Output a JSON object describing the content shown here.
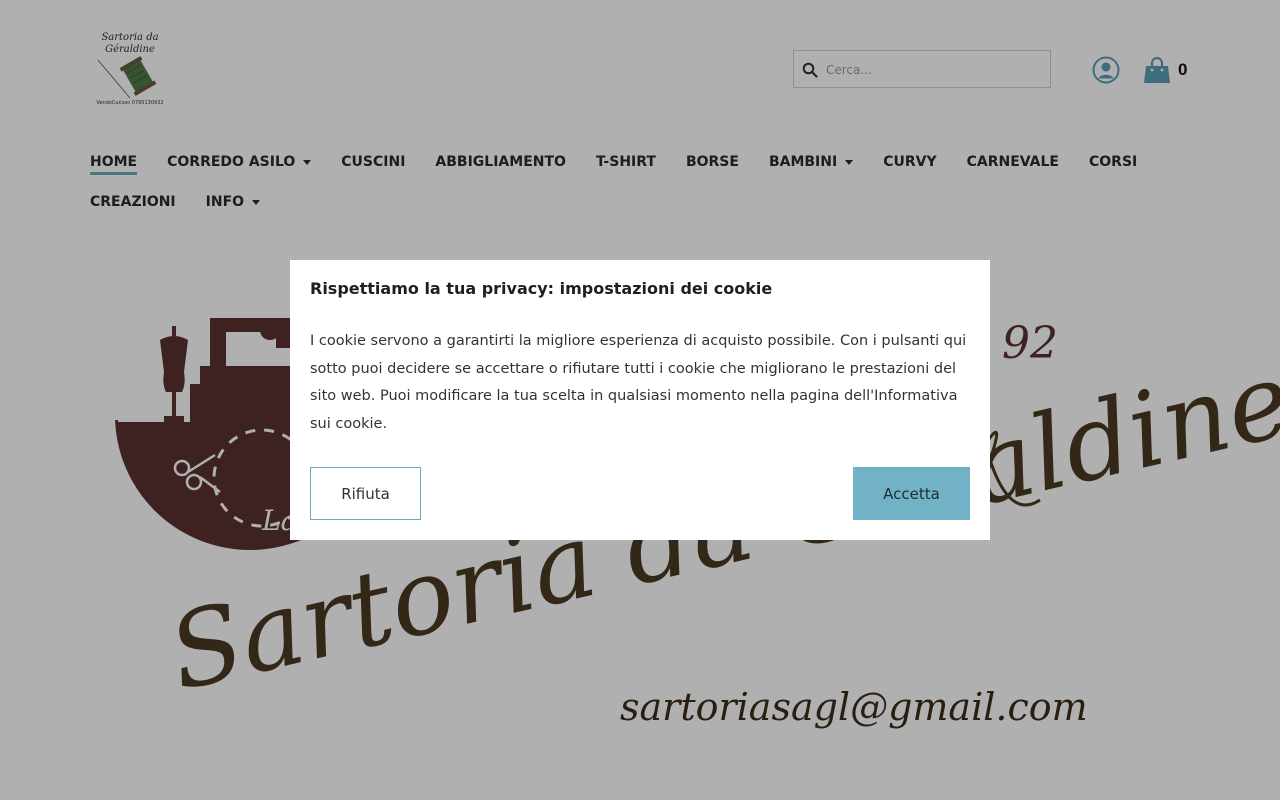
{
  "logo": {
    "line1": "Sartoria da",
    "line2": "Géraldine",
    "line3": "VendoCucuso 0795130932"
  },
  "search": {
    "placeholder": "Cerca..."
  },
  "header": {
    "cart_count": "0"
  },
  "nav": {
    "row1": [
      {
        "label": "HOME",
        "active": true
      },
      {
        "label": "CORREDO ASILO",
        "dropdown": true
      },
      {
        "label": "CUSCINI"
      },
      {
        "label": "ABBIGLIAMENTO"
      },
      {
        "label": "T-SHIRT"
      },
      {
        "label": "BORSE"
      },
      {
        "label": "BAMBINI",
        "dropdown": true
      },
      {
        "label": "CURVY"
      },
      {
        "label": "CARNEVALE"
      },
      {
        "label": "CORSI"
      }
    ],
    "row2": [
      {
        "label": "CREAZIONI"
      },
      {
        "label": "INFO",
        "dropdown": true
      }
    ]
  },
  "hero": {
    "phone_fragment": "3 92",
    "badge_fragment": "La",
    "brand_script": "Sartoria da Géraldine",
    "email": "sartoriasagl@gmail.com"
  },
  "cookie_modal": {
    "title": "Rispettiamo la tua privacy: impostazioni dei cookie",
    "body": "I cookie servono a garantirti la migliore esperienza di acquisto possibile. Con i pulsanti qui sotto puoi decidere se accettare o rifiutare tutti i cookie che migliorano le prestazioni del sito web. Puoi modificare la tua scelta in qualsiasi momento nella pagina dell'Informativa sui cookie.",
    "reject_label": "Rifiuta",
    "accept_label": "Accetta"
  },
  "colors": {
    "accent": "#71b2c6",
    "icon": "#5a9fb6",
    "brand_brown": "#5a3232",
    "script_brown": "#4a3a22",
    "overlay": "rgba(0,0,0,0.31)"
  }
}
